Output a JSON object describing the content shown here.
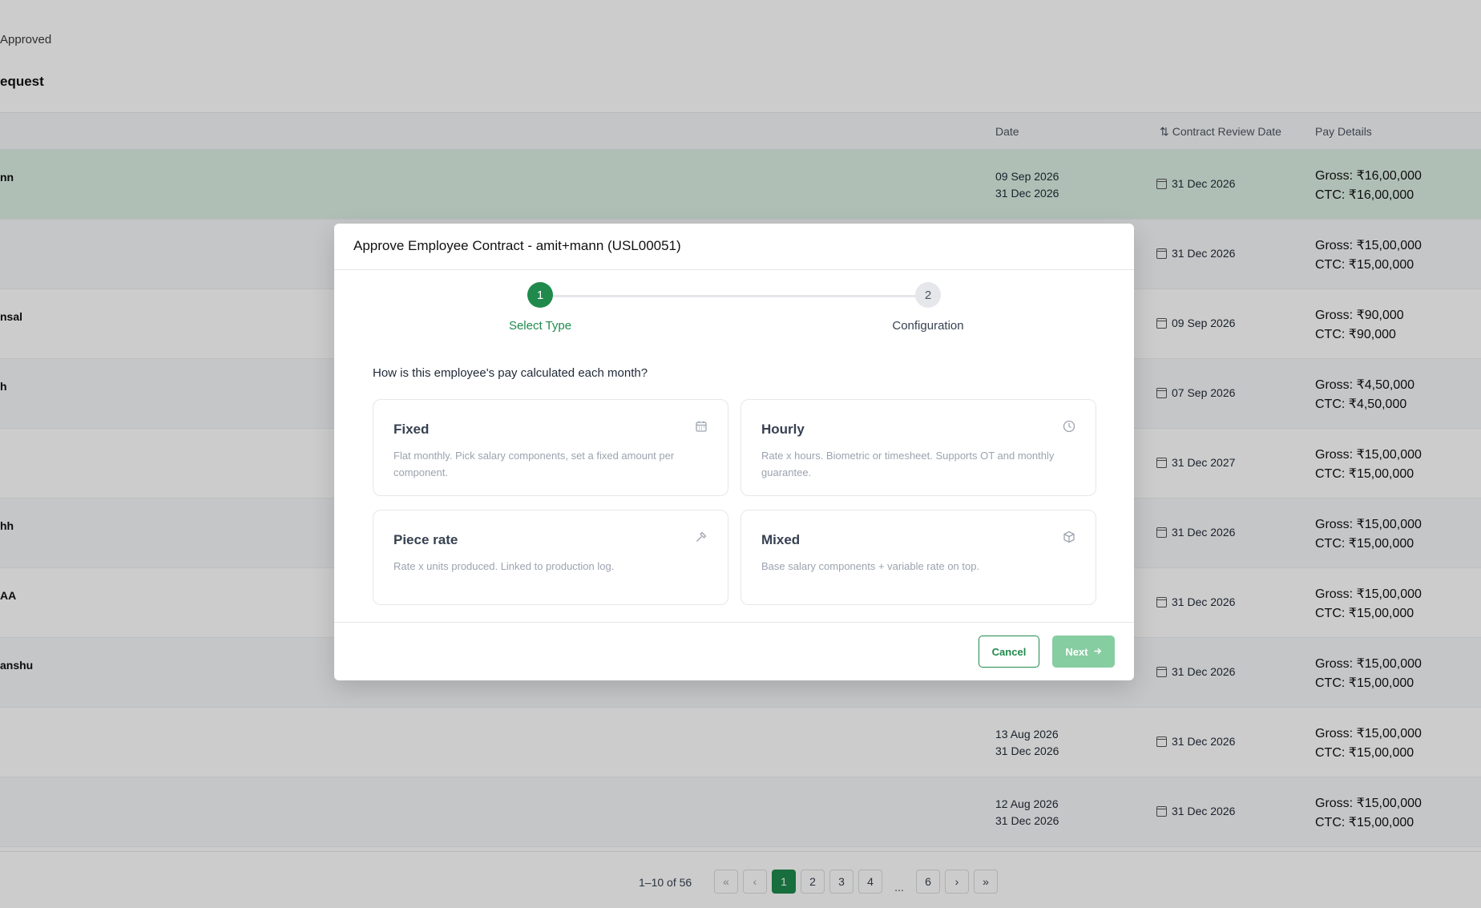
{
  "page": {
    "breadcrumb": "Approved",
    "title": "equest",
    "columns": {
      "date": "Date",
      "review": "Contract Review Date",
      "pay": "Pay Details"
    },
    "rows": [
      {
        "name": "nn",
        "date1": "09 Sep 2026",
        "date2": "31 Dec 2026",
        "review": "31 Dec 2026",
        "gross": "Gross: ₹16,00,000",
        "ctc": "CTC: ₹16,00,000"
      },
      {
        "name": "",
        "date1": "",
        "date2": "",
        "review": "31 Dec 2026",
        "gross": "Gross: ₹15,00,000",
        "ctc": "CTC: ₹15,00,000"
      },
      {
        "name": "nsal",
        "date1": "",
        "date2": "",
        "review": "09 Sep 2026",
        "gross": "Gross: ₹90,000",
        "ctc": "CTC: ₹90,000"
      },
      {
        "name": "h",
        "date1": "",
        "date2": "",
        "review": "07 Sep 2026",
        "gross": "Gross: ₹4,50,000",
        "ctc": "CTC: ₹4,50,000"
      },
      {
        "name": "",
        "date1": "",
        "date2": "",
        "review": "31 Dec 2027",
        "gross": "Gross: ₹15,00,000",
        "ctc": "CTC: ₹15,00,000"
      },
      {
        "name": "hh",
        "date1": "",
        "date2": "",
        "review": "31 Dec 2026",
        "gross": "Gross: ₹15,00,000",
        "ctc": "CTC: ₹15,00,000"
      },
      {
        "name": "AA",
        "date1": "",
        "date2": "",
        "review": "31 Dec 2026",
        "gross": "Gross: ₹15,00,000",
        "ctc": "CTC: ₹15,00,000"
      },
      {
        "name": "anshu",
        "date1": "",
        "date2": "",
        "review": "31 Dec 2026",
        "gross": "Gross: ₹15,00,000",
        "ctc": "CTC: ₹15,00,000"
      },
      {
        "name": "",
        "date1": "13 Aug 2026",
        "date2": "31 Dec 2026",
        "review": "31 Dec 2026",
        "gross": "Gross: ₹15,00,000",
        "ctc": "CTC: ₹15,00,000"
      },
      {
        "name": "",
        "date1": "12 Aug 2026",
        "date2": "31 Dec 2026",
        "review": "31 Dec 2026",
        "gross": "Gross: ₹15,00,000",
        "ctc": "CTC: ₹15,00,000"
      }
    ],
    "pagination": {
      "count": "1–10 of 56",
      "first": "«",
      "prev": "‹",
      "pages": [
        "1",
        "2",
        "3",
        "4"
      ],
      "ellipsis": "...",
      "last_page": "6",
      "next": "›",
      "last": "»",
      "current": "1"
    }
  },
  "modal": {
    "title": "Approve Employee Contract - amit+mann (USL00051)",
    "steps": [
      {
        "number": "1",
        "label": "Select Type",
        "state": "active"
      },
      {
        "number": "2",
        "label": "Configuration",
        "state": "pending"
      }
    ],
    "question": "How is this employee's pay calculated each month?",
    "options": [
      {
        "title": "Fixed",
        "description": "Flat monthly. Pick salary components, set a fixed amount per component.",
        "icon": "calendar-icon"
      },
      {
        "title": "Hourly",
        "description": "Rate x hours. Biometric or timesheet. Supports OT and monthly guarantee.",
        "icon": "clock-icon"
      },
      {
        "title": "Piece rate",
        "description": "Rate x units produced. Linked to production log.",
        "icon": "hammer-icon"
      },
      {
        "title": "Mixed",
        "description": "Base salary components + variable rate on top.",
        "icon": "box-icon"
      }
    ],
    "cancel_label": "Cancel",
    "next_label": "Next",
    "colors": {
      "accent": "#1f8a4c",
      "next_disabled": "#86cda1"
    }
  }
}
